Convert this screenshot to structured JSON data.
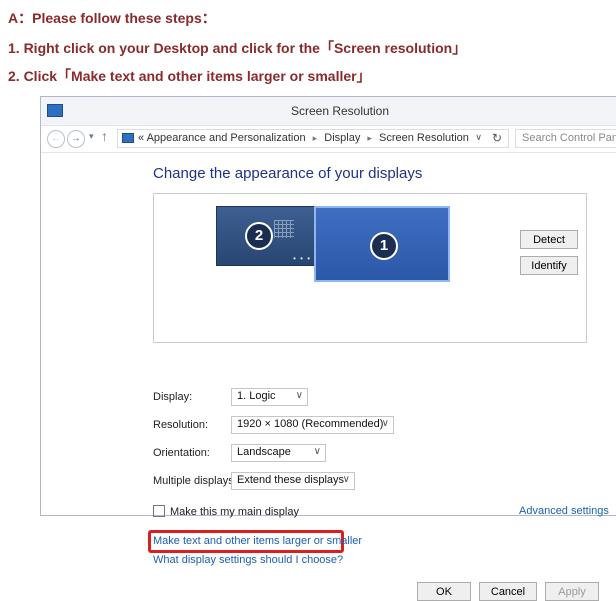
{
  "instructions": {
    "heading": "A：Please follow these steps：",
    "step1": "1.  Right click on your   Desktop   and click for the「Screen resolution」",
    "step2": "2.  Click「Make text and other items larger or smaller」"
  },
  "window": {
    "title": "Screen Resolution"
  },
  "address_bar": {
    "back_glyph": "←",
    "forward_glyph": "→",
    "recent_glyph": "▾",
    "up_glyph": "↑",
    "overflow": "«",
    "crumbs": [
      "Appearance and Personalization",
      "Display",
      "Screen Resolution"
    ],
    "separator": "▸",
    "dropdown_glyph": "∨",
    "refresh_glyph": "↻",
    "search_placeholder": "Search Control Panel"
  },
  "panel": {
    "heading": "Change the appearance of your displays",
    "monitors": [
      {
        "number": "2"
      },
      {
        "number": "1"
      }
    ],
    "dots": "• • •",
    "detect_button": "Detect",
    "identify_button": "Identify",
    "display_label": "Display:",
    "display_value": "1. Logic",
    "resolution_label": "Resolution:",
    "resolution_value": "1920 × 1080 (Recommended)",
    "orientation_label": "Orientation:",
    "orientation_value": "Landscape",
    "multiple_label": "Multiple displays:",
    "multiple_value": "Extend these displays",
    "chevron": "∨",
    "main_display_checkbox": "Make this my main display",
    "advanced_link": "Advanced settings",
    "text_size_link": "Make text and other items larger or smaller",
    "which_settings_link": "What display settings should I choose?",
    "ok_button": "OK",
    "cancel_button": "Cancel",
    "apply_button": "Apply"
  },
  "colors": {
    "instruction_text": "#8a2a2a",
    "heading_blue": "#1e3287",
    "link_blue": "#1a5fb4",
    "highlight_red": "#dc1e1e",
    "monitor_blue": "#2c58a8"
  },
  "icons": [
    "control-panel-icon",
    "back-arrow-icon",
    "forward-arrow-icon",
    "up-arrow-icon",
    "refresh-icon",
    "chevron-down-icon"
  ]
}
